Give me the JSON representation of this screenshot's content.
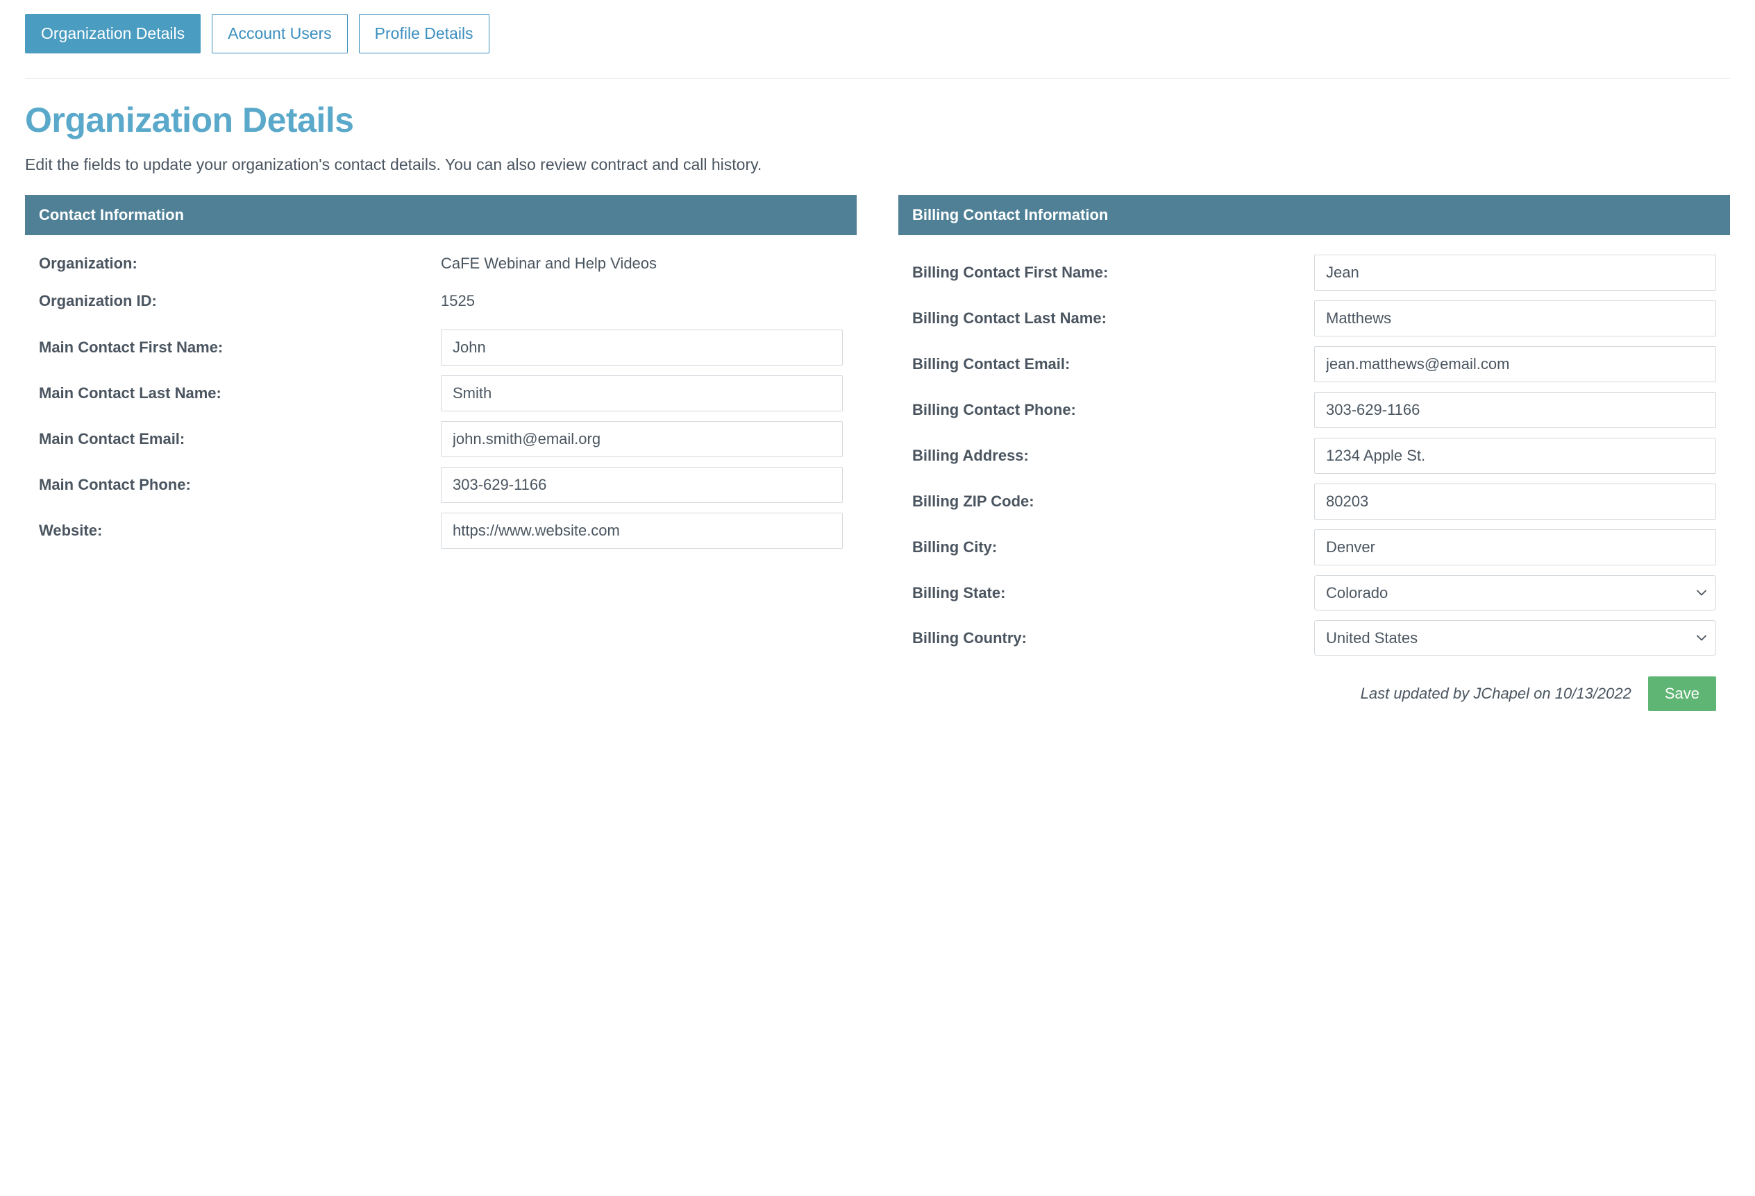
{
  "tabs": {
    "org_details": "Organization Details",
    "account_users": "Account Users",
    "profile_details": "Profile Details"
  },
  "page": {
    "title": "Organization Details",
    "subtitle": "Edit the fields to update your organization's contact details. You can also review contract and call history."
  },
  "contact": {
    "header": "Contact Information",
    "labels": {
      "organization": "Organization:",
      "organization_id": "Organization ID:",
      "first_name": "Main Contact First Name:",
      "last_name": "Main Contact Last Name:",
      "email": "Main Contact Email:",
      "phone": "Main Contact Phone:",
      "website": "Website:"
    },
    "values": {
      "organization": "CaFE Webinar and Help Videos",
      "organization_id": "1525",
      "first_name": "John",
      "last_name": "Smith",
      "email": "john.smith@email.org",
      "phone": "303-629-1166",
      "website": "https://www.website.com"
    }
  },
  "billing": {
    "header": "Billing Contact Information",
    "labels": {
      "first_name": "Billing Contact First Name:",
      "last_name": "Billing Contact Last Name:",
      "email": "Billing Contact Email:",
      "phone": "Billing Contact Phone:",
      "address": "Billing Address:",
      "zip": "Billing ZIP Code:",
      "city": "Billing City:",
      "state": "Billing State:",
      "country": "Billing Country:"
    },
    "values": {
      "first_name": "Jean",
      "last_name": "Matthews",
      "email": "jean.matthews@email.com",
      "phone": "303-629-1166",
      "address": "1234 Apple St.",
      "zip": "80203",
      "city": "Denver",
      "state": "Colorado",
      "country": "United States"
    }
  },
  "footer": {
    "last_updated": "Last updated by JChapel on 10/13/2022",
    "save": "Save"
  }
}
